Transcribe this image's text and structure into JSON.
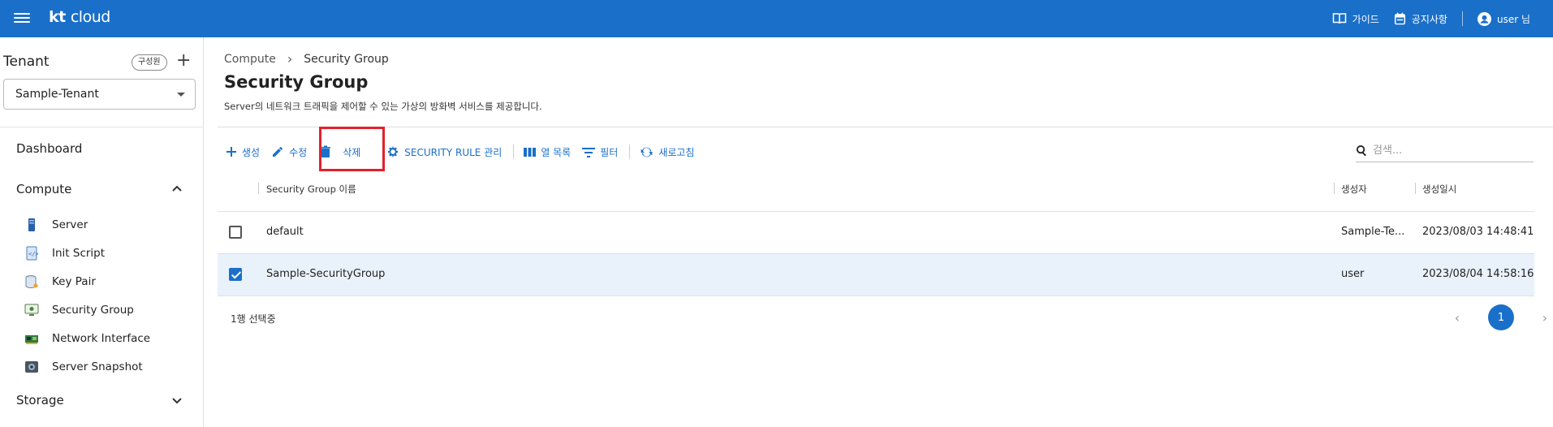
{
  "header": {
    "logo_kt": "kt",
    "logo_cloud": "cloud",
    "guide": "가이드",
    "notice": "공지사항",
    "user": "user 님"
  },
  "sidebar": {
    "tenant_title": "Tenant",
    "member_btn": "구성원",
    "tenant_value": "Sample-Tenant",
    "dashboard": "Dashboard",
    "compute": "Compute",
    "items": [
      {
        "label": "Server",
        "icon": "server-icon"
      },
      {
        "label": "Init Script",
        "icon": "script-icon"
      },
      {
        "label": "Key Pair",
        "icon": "key-pair-icon"
      },
      {
        "label": "Security Group",
        "icon": "security-group-icon"
      },
      {
        "label": "Network Interface",
        "icon": "network-card-icon"
      },
      {
        "label": "Server Snapshot",
        "icon": "snapshot-icon"
      }
    ],
    "storage": "Storage"
  },
  "main": {
    "breadcrumb": [
      "Compute",
      "Security Group"
    ],
    "title": "Security Group",
    "description": "Server의 네트워크 트래픽을 제어할 수 있는 가상의 방화벽 서비스를 제공합니다.",
    "toolbar": {
      "create": "생성",
      "edit": "수정",
      "delete": "삭제",
      "rules": "SECURITY RULE 관리",
      "columns": "열 목록",
      "filter": "필터",
      "refresh": "새로고침"
    },
    "search_placeholder": "검색...",
    "columns": [
      "Security Group 이름",
      "생성자",
      "생성일시"
    ],
    "rows": [
      {
        "name": "default",
        "creator": "Sample-Te...",
        "created": "2023/08/03 14:48:41",
        "selected": false
      },
      {
        "name": "Sample-SecurityGroup",
        "creator": "user",
        "created": "2023/08/04 14:58:16",
        "selected": true
      }
    ],
    "selected_count": "1행 선택중",
    "page": "1"
  },
  "colors": {
    "primary": "#1a6fc9",
    "highlight": "#e4202b",
    "selected_row": "#e9f1fa"
  }
}
